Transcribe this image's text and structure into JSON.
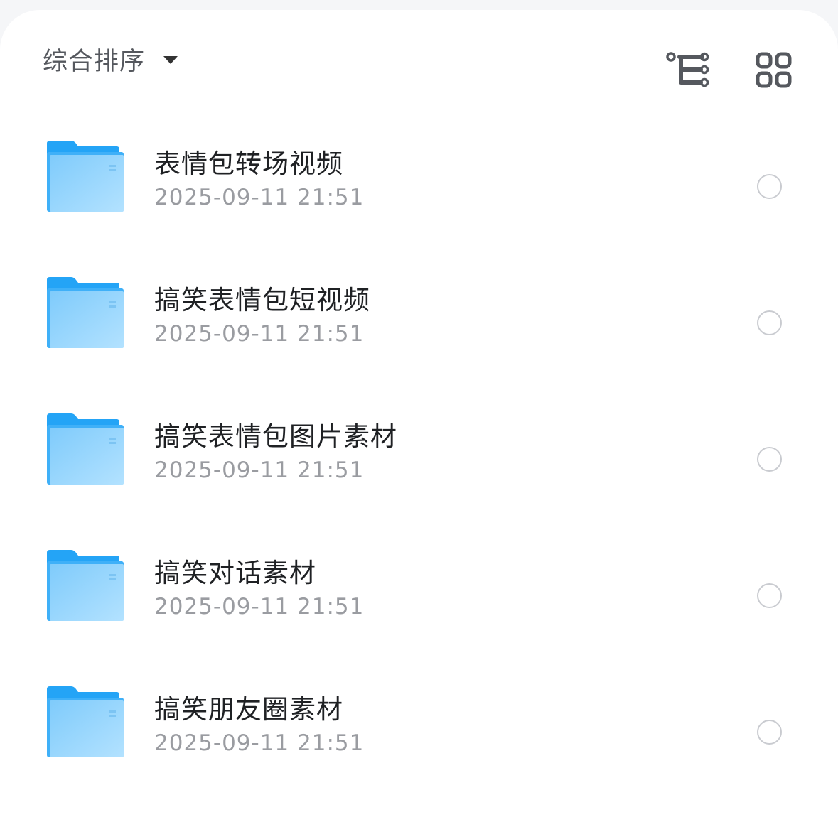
{
  "toolbar": {
    "sort_label": "综合排序",
    "sort_caret_icon": "caret-down-icon",
    "tree_icon": "tree-structure-icon",
    "grid_icon": "grid-view-icon"
  },
  "colors": {
    "folder_light": "#a6dcfd",
    "folder_dark": "#24a4f6",
    "radio_border": "#c9cbd0"
  },
  "items": [
    {
      "name": "表情包转场视频",
      "time": "2025-09-11 21:51"
    },
    {
      "name": "搞笑表情包短视频",
      "time": "2025-09-11 21:51"
    },
    {
      "name": "搞笑表情包图片素材",
      "time": "2025-09-11 21:51"
    },
    {
      "name": "搞笑对话素材",
      "time": "2025-09-11 21:51"
    },
    {
      "name": "搞笑朋友圈素材",
      "time": "2025-09-11 21:51"
    }
  ]
}
